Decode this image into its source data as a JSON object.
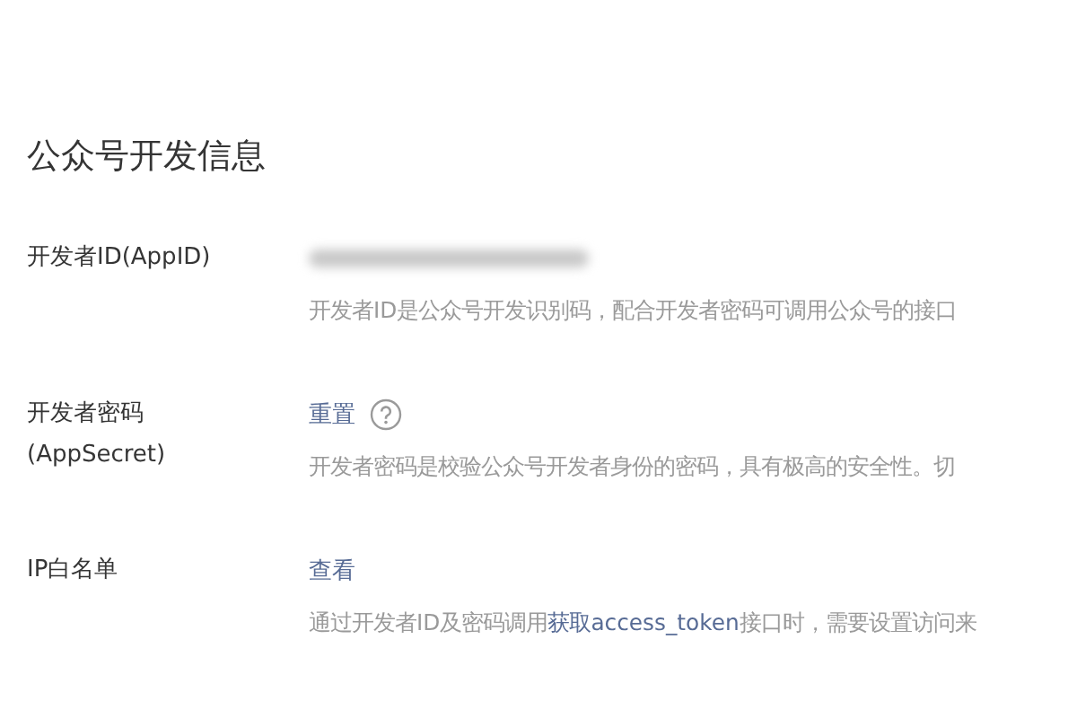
{
  "title": "公众号开发信息",
  "rows": [
    {
      "kind": "secret",
      "label": [
        "开发者ID(AppID)"
      ],
      "description": {
        "text": "开发者ID是公众号开发识别码，配合开发者密码可调用公众号的接口"
      }
    },
    {
      "kind": "action",
      "label": [
        "开发者密码",
        "(AppSecret)"
      ],
      "action": "重置",
      "help": true,
      "description": {
        "text": "开发者密码是校验公众号开发者身份的密码，具有极高的安全性。切"
      }
    },
    {
      "kind": "action",
      "label": [
        "IP白名单"
      ],
      "action": "查看",
      "help": false,
      "description": {
        "text": "通过开发者ID及密码调用",
        "link": "获取access_token",
        "after": "接口时，需要设置访问来"
      }
    }
  ]
}
